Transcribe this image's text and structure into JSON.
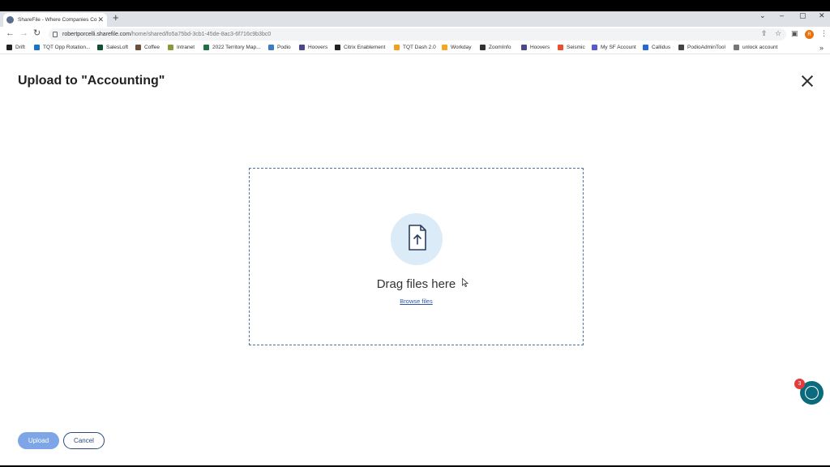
{
  "browser": {
    "tab_title": "ShareFile - Where Companies Co",
    "tab_close": "✕",
    "new_tab": "+",
    "url_host": "robertporcelli.sharefile.com",
    "url_path": "/home/shared/fo5a75bd-3cb1-45de-8ac3-6f716c9b3bc0",
    "profile_initial": "R"
  },
  "bookmarks": [
    {
      "label": "Drift",
      "color": "#222222"
    },
    {
      "label": "TQT Opp Rotation...",
      "color": "#1a73c7"
    },
    {
      "label": "SalesLoft",
      "color": "#0f5132"
    },
    {
      "label": "Coffee",
      "color": "#6b4f3a"
    },
    {
      "label": "Intranet",
      "color": "#8a9a3b"
    },
    {
      "label": "2022 Territory Map...",
      "color": "#1e7145"
    },
    {
      "label": "Podio",
      "color": "#3b7dc4"
    },
    {
      "label": "Hoovers",
      "color": "#4a4a8a"
    },
    {
      "label": "Citrix Enablement",
      "color": "#222222"
    },
    {
      "label": "TQT Dash 2.0",
      "color": "#f0a020"
    },
    {
      "label": "Workday",
      "color": "#f5a623"
    },
    {
      "label": "ZoomInfo",
      "color": "#333333"
    },
    {
      "label": "Hoovers",
      "color": "#4a4a8a"
    },
    {
      "label": "Seismic",
      "color": "#e8502a"
    },
    {
      "label": "My SF Account",
      "color": "#5a5ad0"
    },
    {
      "label": "Callidus",
      "color": "#2a6ad0"
    },
    {
      "label": "PodioAdminTool",
      "color": "#444444"
    },
    {
      "label": "unlock account",
      "color": "#777777"
    }
  ],
  "dialog": {
    "title": "Upload to \"Accounting\"",
    "drop_text": "Drag files here",
    "browse_link": "Browse files",
    "upload_button": "Upload",
    "cancel_button": "Cancel"
  },
  "help": {
    "badge_count": "3"
  },
  "colors": {
    "accent": "#2c5aa0",
    "upload_button": "#7ea5e6",
    "fab": "#0a6b7c"
  }
}
